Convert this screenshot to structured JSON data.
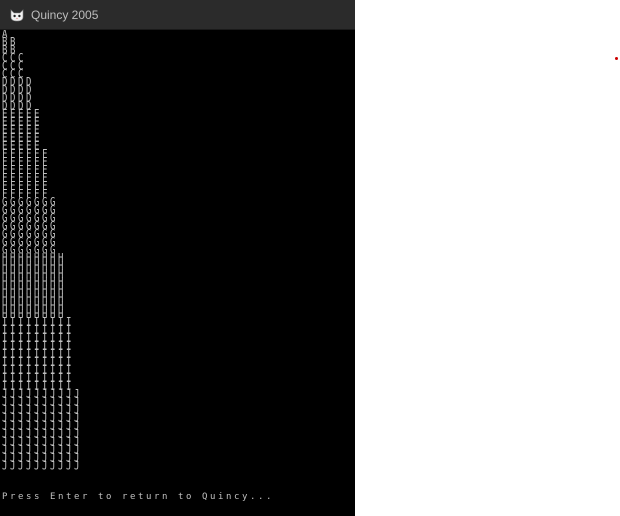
{
  "window": {
    "title": "Quincy 2005",
    "icon": "quincy-cat-icon"
  },
  "console": {
    "lines": [
      "A",
      "BB",
      "BB",
      "CCC",
      "CCC",
      "CCC",
      "DDDD",
      "DDDD",
      "DDDD",
      "DDDD",
      "EEEEE",
      "EEEEE",
      "EEEEE",
      "EEEEE",
      "EEEEE",
      "FFFFFF",
      "FFFFFF",
      "FFFFFF",
      "FFFFFF",
      "FFFFFF",
      "FFFFFF",
      "GGGGGGG",
      "GGGGGGG",
      "GGGGGGG",
      "GGGGGGG",
      "GGGGGGG",
      "GGGGGGG",
      "GGGGGGG",
      "HHHHHHHH",
      "HHHHHHHH",
      "HHHHHHHH",
      "HHHHHHHH",
      "HHHHHHHH",
      "HHHHHHHH",
      "HHHHHHHH",
      "HHHHHHHH",
      "IIIIIIIII",
      "IIIIIIIII",
      "IIIIIIIII",
      "IIIIIIIII",
      "IIIIIIIII",
      "IIIIIIIII",
      "IIIIIIIII",
      "IIIIIIIII",
      "IIIIIIIII",
      "JJJJJJJJJJ",
      "JJJJJJJJJJ",
      "JJJJJJJJJJ",
      "JJJJJJJJJJ",
      "JJJJJJJJJJ",
      "JJJJJJJJJJ",
      "JJJJJJJJJJ",
      "JJJJJJJJJJ",
      "JJJJJJJJJJ",
      "JJJJJJJJJJ"
    ],
    "prompt": "Press Enter to return to Quincy..."
  },
  "colors": {
    "console_background": "#000000",
    "console_text": "#c0c0c0",
    "titlebar_background": "#2b2b2b",
    "title_text": "#bdbdbd",
    "marker_dot": "#cc0000"
  }
}
